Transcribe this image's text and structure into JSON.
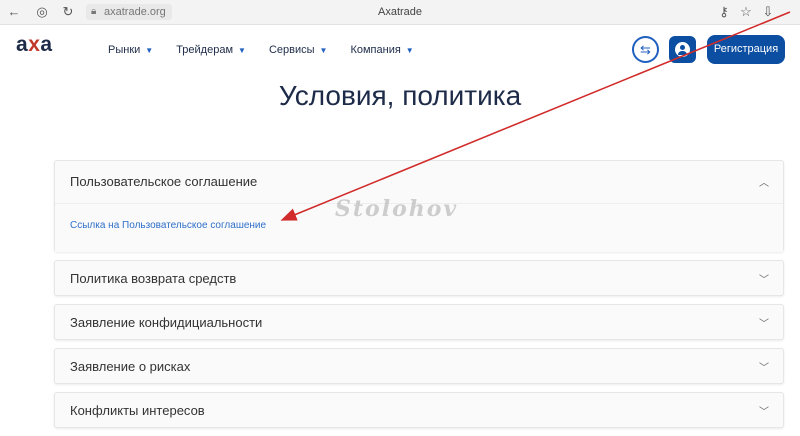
{
  "browser": {
    "url": "axatrade.org",
    "tab_title": "Axatrade"
  },
  "header": {
    "logo_a": "а",
    "logo_x": "х",
    "logo_b": "а",
    "nav": [
      {
        "label": "Рынки"
      },
      {
        "label": "Трейдерам"
      },
      {
        "label": "Сервисы"
      },
      {
        "label": "Компания"
      }
    ],
    "register_label": "Регистрация"
  },
  "page": {
    "title": "Условия, политика"
  },
  "accordion": [
    {
      "label": "Пользовательское соглашение",
      "expanded": true,
      "link": "Ссылка на Пользовательское соглашение"
    },
    {
      "label": "Политика возврата средств",
      "expanded": false
    },
    {
      "label": "Заявление конфидициальности",
      "expanded": false
    },
    {
      "label": "Заявление о рисках",
      "expanded": false
    },
    {
      "label": "Конфликты интересов",
      "expanded": false
    }
  ],
  "watermark": "Stolohov",
  "colors": {
    "brand": "#0b4ea2",
    "accent_arrow": "#d12b2b",
    "link": "#2f6fc9"
  }
}
